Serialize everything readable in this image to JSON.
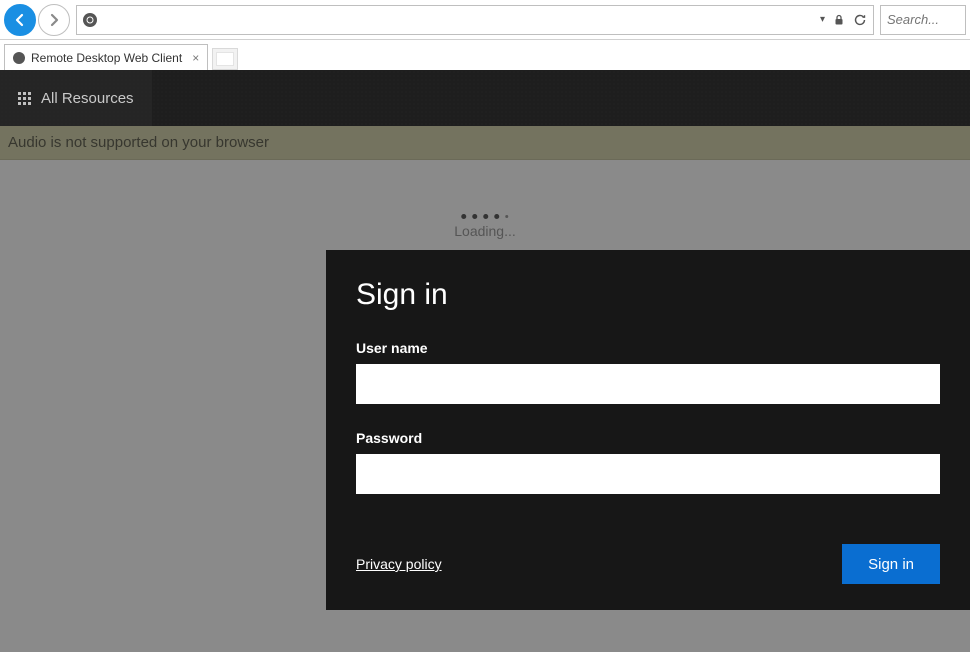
{
  "browser": {
    "address_value": "",
    "search_placeholder": "Search...",
    "tab": {
      "title": "Remote Desktop Web Client"
    }
  },
  "app_header": {
    "all_resources": "All Resources"
  },
  "banner": {
    "message": "Audio is not supported on your browser"
  },
  "loading": {
    "text": "Loading..."
  },
  "signin": {
    "title": "Sign in",
    "username_label": "User name",
    "username_value": "",
    "password_label": "Password",
    "password_value": "",
    "privacy_label": "Privacy policy",
    "button_label": "Sign in"
  }
}
